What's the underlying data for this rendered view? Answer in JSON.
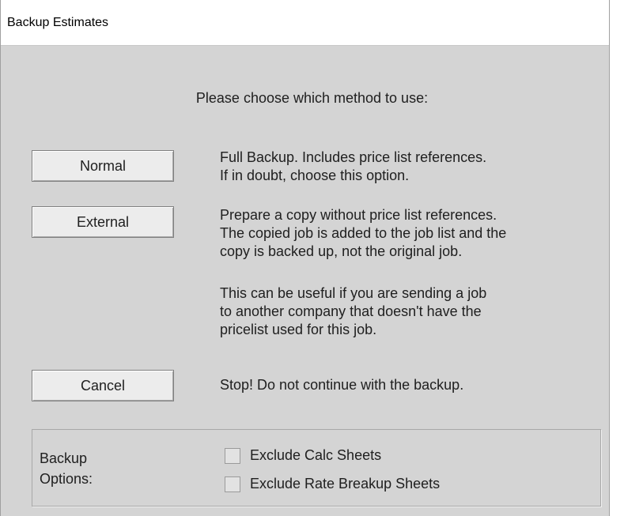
{
  "window": {
    "title": "Backup Estimates"
  },
  "prompt": "Please choose which method to use:",
  "options": {
    "normal": {
      "button_label": "Normal",
      "description": [
        "Full Backup. Includes price list references.",
        "If in doubt, choose this option."
      ]
    },
    "external": {
      "button_label": "External",
      "description": [
        "Prepare a copy without price list references.",
        "The copied job is added to the job list and the",
        "copy is backed up, not the original job."
      ],
      "note": [
        "This can be useful if you are sending a job",
        "to another company that doesn't have the",
        "pricelist used for this job."
      ]
    },
    "cancel": {
      "button_label": "Cancel",
      "description": [
        "Stop! Do not continue with the backup."
      ]
    }
  },
  "backup_options": {
    "label_line1": "Backup",
    "label_line2": "Options:",
    "checkboxes": [
      {
        "label": "Exclude Calc Sheets",
        "checked": false
      },
      {
        "label": "Exclude Rate Breakup Sheets",
        "checked": false
      }
    ]
  },
  "colors": {
    "dialog_background": "#d4d4d4",
    "titlebar_background": "#ffffff",
    "button_face": "#ececec"
  }
}
